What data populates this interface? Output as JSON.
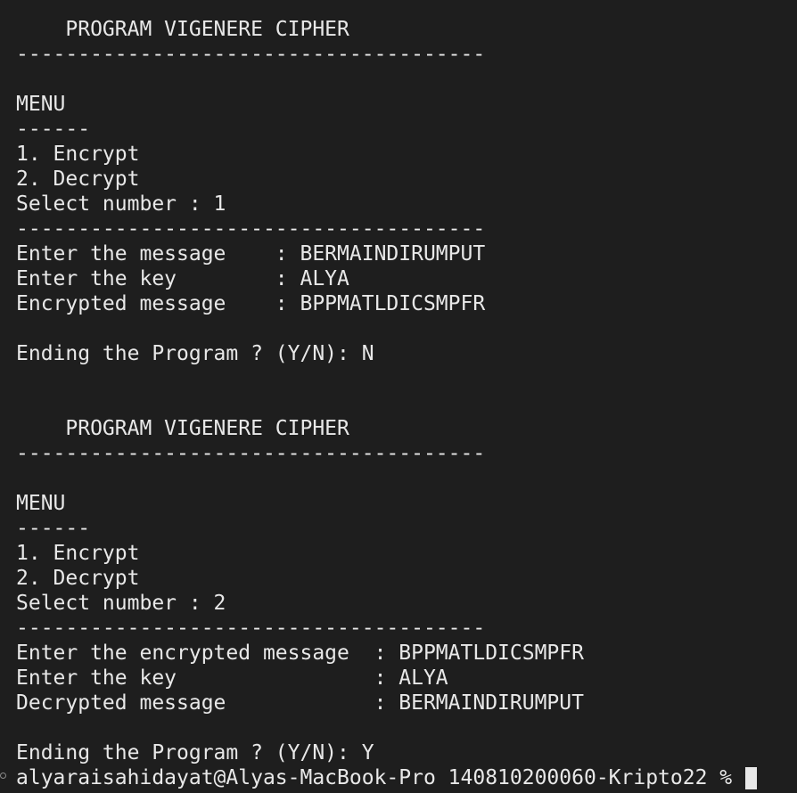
{
  "terminal": {
    "lines": [
      "    PROGRAM VIGENERE CIPHER",
      "--------------------------------------",
      "",
      "MENU",
      "------",
      "1. Encrypt",
      "2. Decrypt",
      "Select number : 1",
      "--------------------------------------",
      "Enter the message    : BERMAINDIRUMPUT",
      "Enter the key        : ALYA",
      "Encrypted message    : BPPMATLDICSMPFR",
      "",
      "Ending the Program ? (Y/N): N",
      "",
      "",
      "    PROGRAM VIGENERE CIPHER",
      "--------------------------------------",
      "",
      "MENU",
      "------",
      "1. Encrypt",
      "2. Decrypt",
      "Select number : 2",
      "--------------------------------------",
      "Enter the encrypted message  : BPPMATLDICSMPFR",
      "Enter the key                : ALYA",
      "Decrypted message            : BERMAINDIRUMPUT",
      "",
      "Ending the Program ? (Y/N): Y"
    ],
    "prompt": "alyaraisahidayat@Alyas-MacBook-Pro 140810200060-Kripto22 % "
  }
}
